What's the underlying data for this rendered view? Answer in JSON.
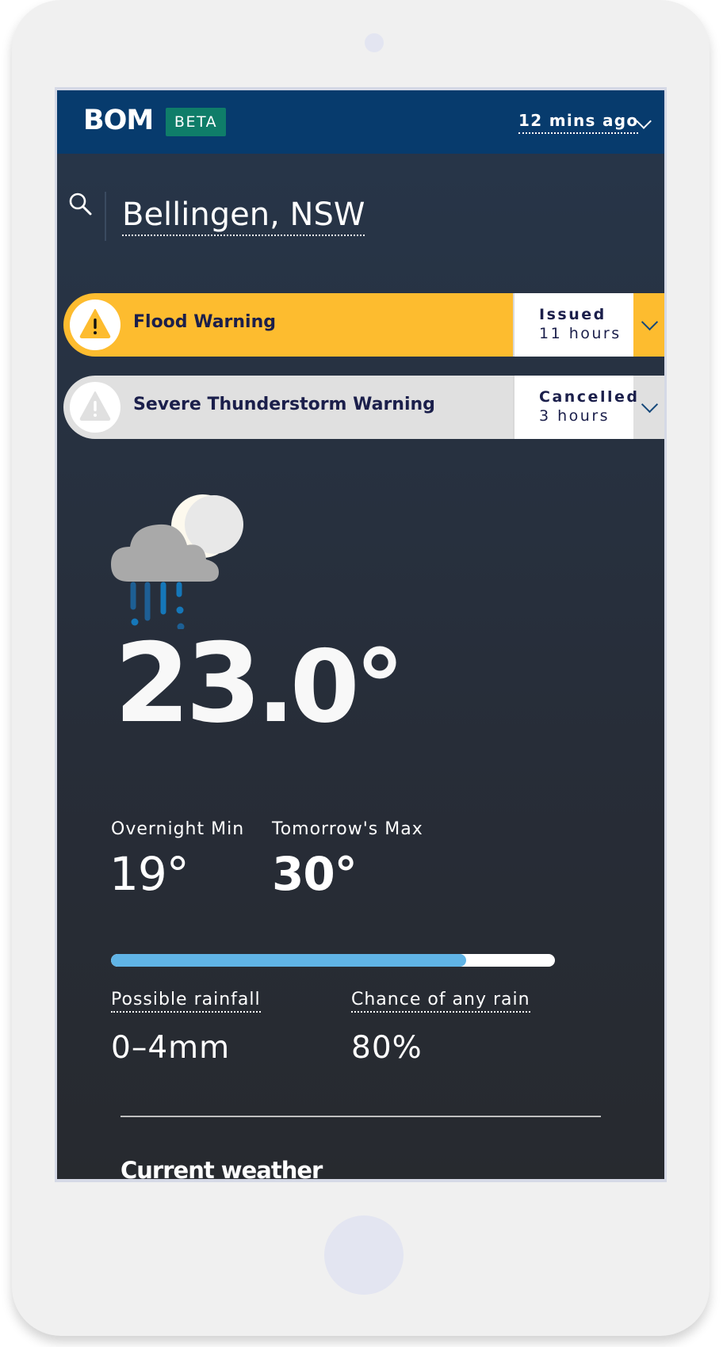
{
  "header": {
    "logo": "BOM",
    "badge": "BETA",
    "updated": "12 mins ago",
    "updated_toggle_icon": "chevron-down-icon"
  },
  "search": {
    "icon": "search-icon",
    "location": "Bellingen, NSW"
  },
  "warnings": [
    {
      "title": "Flood Warning",
      "status": "Issued",
      "time": "11 hours",
      "color": "#fdbc2f",
      "icon": "warning-triangle-icon"
    },
    {
      "title": "Severe Thunderstorm Warning",
      "status": "Cancelled",
      "time": "3 hours",
      "color": "#e0e0e0",
      "icon": "warning-triangle-icon"
    }
  ],
  "current": {
    "icon": "rain-cloud-moon-icon",
    "temp_int": "23",
    "temp_dec": ".0°"
  },
  "forecast": {
    "min_label": "Overnight Min",
    "min_value": "19°",
    "max_label": "Tomorrow's Max",
    "max_value": "30°"
  },
  "rain": {
    "chance_fraction": 0.8,
    "bar_color": "#60b4e6",
    "amount_label": "Possible rainfall",
    "amount_value": "0–4mm",
    "chance_label": "Chance of any rain",
    "chance_value": "80%"
  },
  "sections": {
    "current_weather_title": "Current weather"
  },
  "colors": {
    "header_bg": "#073b6d",
    "badge_bg": "#0f7d69",
    "text_dark": "#1b1f4b"
  }
}
